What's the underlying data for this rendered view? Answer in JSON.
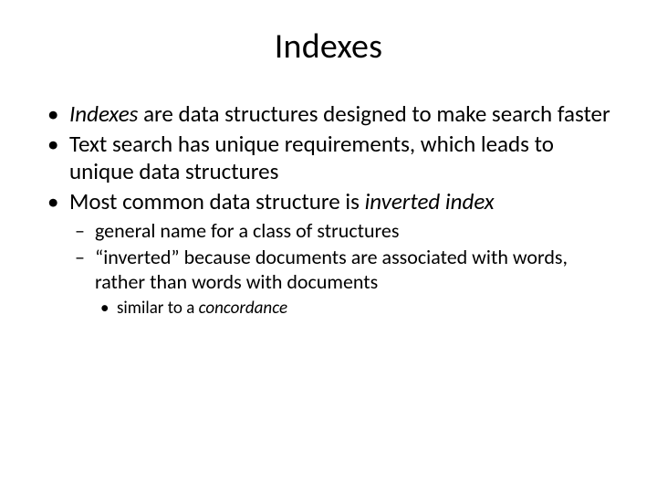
{
  "title": "Indexes",
  "bullets": {
    "b0_italic": "Indexes",
    "b0_rest": " are data structures designed to make search faster",
    "b1": "Text search has unique requirements, which leads to unique data structures",
    "b2_pre": "Most common data structure is ",
    "b2_italic": "inverted index",
    "sub0": "general name for a class of structures",
    "sub1": "“inverted” because documents are associated with words, rather than words with documents",
    "subsub0_pre": "similar to a ",
    "subsub0_italic": "concordance"
  }
}
